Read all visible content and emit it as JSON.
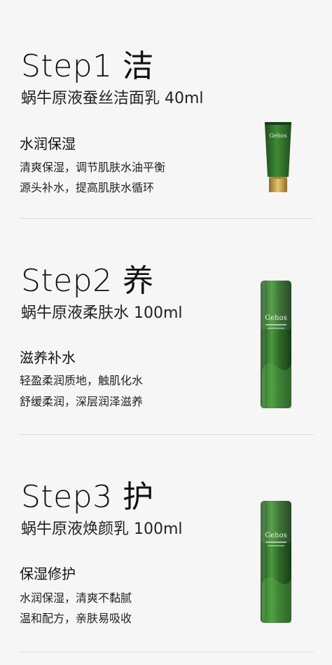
{
  "steps": [
    {
      "title": "Step1 洁",
      "subtitle": "蜗牛原液蚕丝洁面乳 40ml",
      "feature": "水润保湿",
      "desc1": "清爽保湿，调节肌肤水油平衡",
      "desc2": "源头补水，提高肌肤水循环",
      "brand": "Gehos",
      "product_icon": "cleanser-tube-icon"
    },
    {
      "title": "Step2 养",
      "subtitle": "蜗牛原液柔肤水 100ml",
      "feature": "滋养补水",
      "desc1": "轻盈柔润质地，触肌化水",
      "desc2": "舒缓柔润，深层润泽滋养",
      "brand": "Gehos",
      "product_icon": "toner-bottle-icon"
    },
    {
      "title": "Step3 护",
      "subtitle": "蜗牛原液焕颜乳 100ml",
      "feature": "保湿修护",
      "desc1": "水润保湿，清爽不黏腻",
      "desc2": "温和配方，亲肤易吸收",
      "brand": "Gehos",
      "product_icon": "lotion-bottle-icon"
    }
  ],
  "colors": {
    "background": "#f6f6f6",
    "bottle_green": "#2f6b2a",
    "gold_cap": "#c8a54a",
    "divider": "#dcdcdc"
  }
}
